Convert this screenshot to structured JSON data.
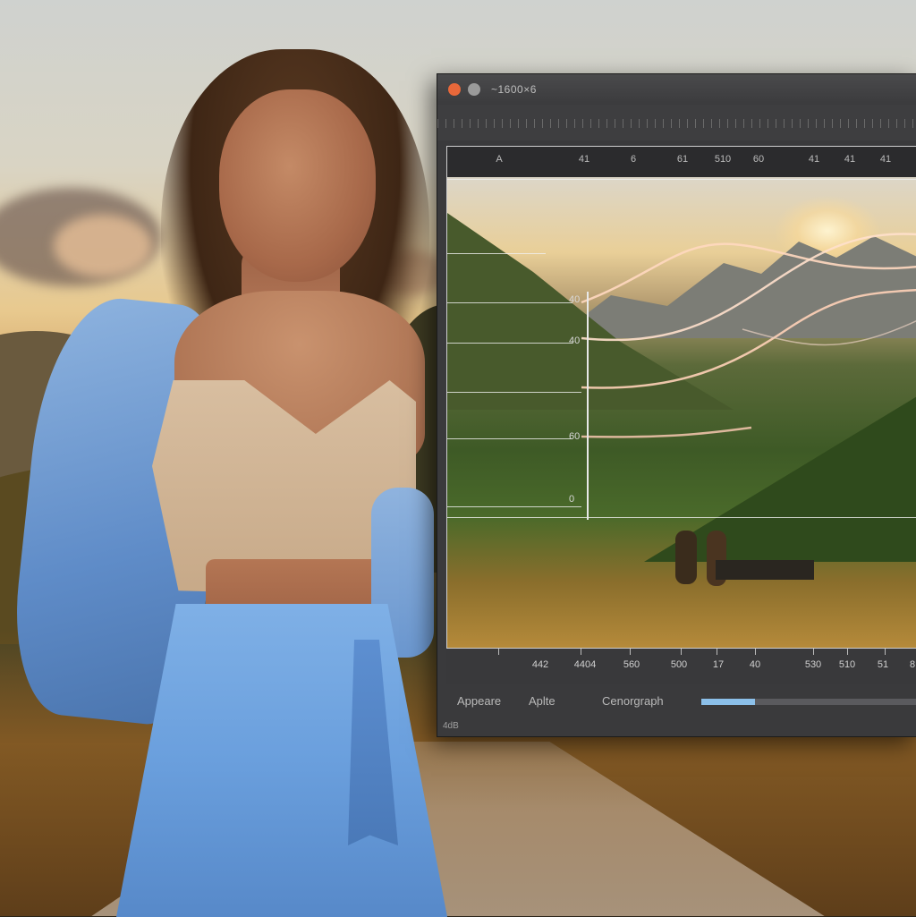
{
  "window": {
    "title": "~1600×6",
    "status": "4dB",
    "accent": "#8cc0ea",
    "close_color": "#e8683a"
  },
  "timeline_header": {
    "labels": [
      "A",
      "41",
      "6",
      "61",
      "510",
      "60",
      "41",
      "41",
      "41"
    ]
  },
  "y_axis": {
    "labels": [
      "40",
      "40",
      "60",
      "0"
    ]
  },
  "bottom_ruler": {
    "labels": [
      "442",
      "4404",
      "560",
      "500",
      "17",
      "40",
      "530",
      "510",
      "51",
      "8"
    ]
  },
  "controls": {
    "appearance_label": "Appeare",
    "apple_label": "Aplte",
    "chronograph_label": "Cenorgraph",
    "progress": 0.23
  }
}
